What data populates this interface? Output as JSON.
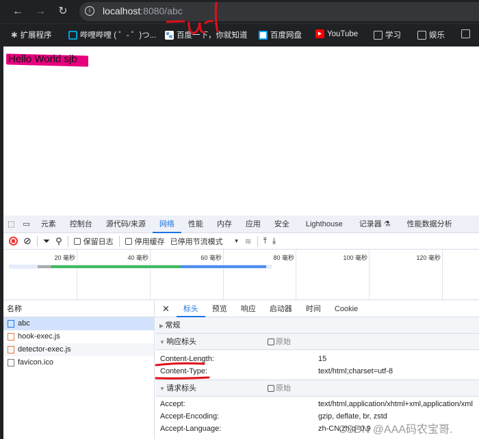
{
  "browser": {
    "url_host": "localhost",
    "url_rest": ":8080/abc",
    "bookmarks": [
      {
        "label": "扩展程序",
        "icon": "puzzle-icon"
      },
      {
        "label": "哔哩哔哩 ( ゜- ゜)つ...",
        "icon": "bilibili-icon"
      },
      {
        "label": "百度一下，你就知道",
        "icon": "baidu-icon"
      },
      {
        "label": "百度网盘",
        "icon": "baidu-netdisk-icon"
      },
      {
        "label": "YouTube",
        "icon": "youtube-icon"
      },
      {
        "label": "学习",
        "icon": "folder-icon"
      },
      {
        "label": "娱乐",
        "icon": "folder-icon"
      }
    ]
  },
  "page": {
    "text": "Hello World sjb"
  },
  "annotations": {
    "url_note": "url",
    "colors": {
      "red": "#e0101a",
      "highlight": "#e6007e"
    }
  },
  "devtools": {
    "tabs": [
      "元素",
      "控制台",
      "源代码/来源",
      "网络",
      "性能",
      "内存",
      "应用",
      "安全",
      "Lighthouse",
      "记录器 ⚗",
      "性能数据分析"
    ],
    "active_tab": "网络",
    "toolbar": {
      "preserve_log": "保留日志",
      "disable_cache": "停用缓存",
      "throttle": "已停用节流模式"
    },
    "timeline_ticks": [
      "20 毫秒",
      "40 毫秒",
      "60 毫秒",
      "80 毫秒",
      "100 毫秒",
      "120 毫秒"
    ],
    "list_header": "名称",
    "requests": [
      {
        "name": "abc",
        "type": "document"
      },
      {
        "name": "hook-exec.js",
        "type": "script"
      },
      {
        "name": "detector-exec.js",
        "type": "script"
      },
      {
        "name": "favicon.ico",
        "type": "other"
      }
    ],
    "detail_tabs": [
      "标头",
      "预览",
      "响应",
      "启动器",
      "时间",
      "Cookie"
    ],
    "active_detail_tab": "标头",
    "sections": {
      "general": "常规",
      "response": "响应标头",
      "request": "请求标头",
      "raw": "原始"
    },
    "response_headers": [
      {
        "k": "Content-Length:",
        "v": "15"
      },
      {
        "k": "Content-Type:",
        "v": "text/html;charset=utf-8"
      }
    ],
    "request_headers": [
      {
        "k": "Accept:",
        "v": "text/html,application/xhtml+xml,application/xml"
      },
      {
        "k": "Accept-Encoding:",
        "v": "gzip, deflate, br, zstd"
      },
      {
        "k": "Accept-Language:",
        "v": "zh-CN,zh;q=0.9"
      }
    ]
  },
  "watermark": "CSDN @AAA码农宝哥."
}
